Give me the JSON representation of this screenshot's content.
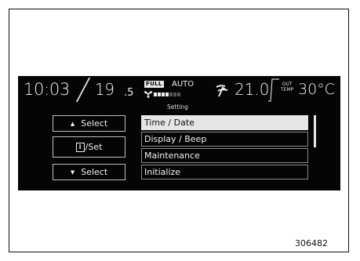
{
  "status_bar": {
    "clock": "10:03",
    "left_temp_whole": "19",
    "left_temp_decimal": ".5",
    "full_badge": "FULL",
    "auto_label": "AUTO",
    "right_temp": "21.0",
    "out_temp_label_1": "OUT",
    "out_temp_label_2": "TEMP",
    "out_temp_value": "30°C",
    "fan_level_filled": 4,
    "fan_level_total": 7
  },
  "menu": {
    "title": "Setting",
    "items": [
      {
        "label": "Time / Date",
        "selected": true
      },
      {
        "label": "Display / Beep",
        "selected": false
      },
      {
        "label": "Maintenance",
        "selected": false
      },
      {
        "label": "Initialize",
        "selected": false
      }
    ]
  },
  "controls": {
    "up_label": "Select",
    "set_label": "/Set",
    "info_glyph": "i",
    "down_label": "Select"
  },
  "figure_number": "306482",
  "colors": {
    "screen_bg": "#050505",
    "selected_bg": "#e6e6e6",
    "text": "#f0f0f0"
  }
}
